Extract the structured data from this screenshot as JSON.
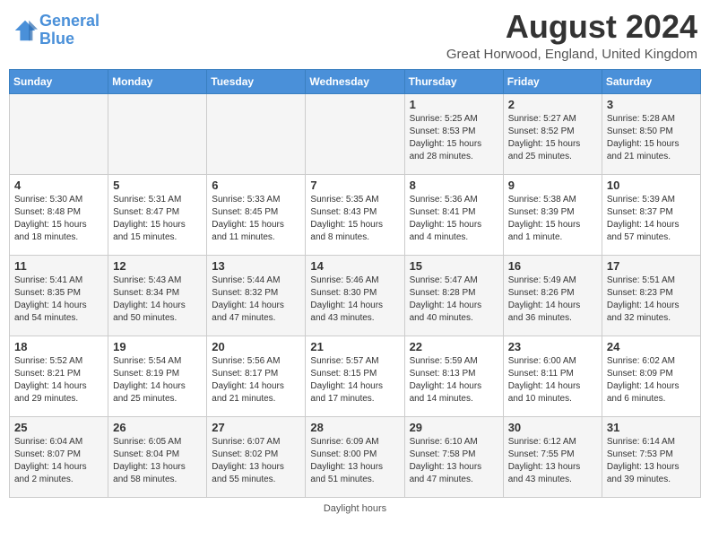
{
  "header": {
    "logo_general": "General",
    "logo_blue": "Blue",
    "month_title": "August 2024",
    "location": "Great Horwood, England, United Kingdom"
  },
  "days_of_week": [
    "Sunday",
    "Monday",
    "Tuesday",
    "Wednesday",
    "Thursday",
    "Friday",
    "Saturday"
  ],
  "weeks": [
    [
      {
        "day": "",
        "info": ""
      },
      {
        "day": "",
        "info": ""
      },
      {
        "day": "",
        "info": ""
      },
      {
        "day": "",
        "info": ""
      },
      {
        "day": "1",
        "info": "Sunrise: 5:25 AM\nSunset: 8:53 PM\nDaylight: 15 hours\nand 28 minutes."
      },
      {
        "day": "2",
        "info": "Sunrise: 5:27 AM\nSunset: 8:52 PM\nDaylight: 15 hours\nand 25 minutes."
      },
      {
        "day": "3",
        "info": "Sunrise: 5:28 AM\nSunset: 8:50 PM\nDaylight: 15 hours\nand 21 minutes."
      }
    ],
    [
      {
        "day": "4",
        "info": "Sunrise: 5:30 AM\nSunset: 8:48 PM\nDaylight: 15 hours\nand 18 minutes."
      },
      {
        "day": "5",
        "info": "Sunrise: 5:31 AM\nSunset: 8:47 PM\nDaylight: 15 hours\nand 15 minutes."
      },
      {
        "day": "6",
        "info": "Sunrise: 5:33 AM\nSunset: 8:45 PM\nDaylight: 15 hours\nand 11 minutes."
      },
      {
        "day": "7",
        "info": "Sunrise: 5:35 AM\nSunset: 8:43 PM\nDaylight: 15 hours\nand 8 minutes."
      },
      {
        "day": "8",
        "info": "Sunrise: 5:36 AM\nSunset: 8:41 PM\nDaylight: 15 hours\nand 4 minutes."
      },
      {
        "day": "9",
        "info": "Sunrise: 5:38 AM\nSunset: 8:39 PM\nDaylight: 15 hours\nand 1 minute."
      },
      {
        "day": "10",
        "info": "Sunrise: 5:39 AM\nSunset: 8:37 PM\nDaylight: 14 hours\nand 57 minutes."
      }
    ],
    [
      {
        "day": "11",
        "info": "Sunrise: 5:41 AM\nSunset: 8:35 PM\nDaylight: 14 hours\nand 54 minutes."
      },
      {
        "day": "12",
        "info": "Sunrise: 5:43 AM\nSunset: 8:34 PM\nDaylight: 14 hours\nand 50 minutes."
      },
      {
        "day": "13",
        "info": "Sunrise: 5:44 AM\nSunset: 8:32 PM\nDaylight: 14 hours\nand 47 minutes."
      },
      {
        "day": "14",
        "info": "Sunrise: 5:46 AM\nSunset: 8:30 PM\nDaylight: 14 hours\nand 43 minutes."
      },
      {
        "day": "15",
        "info": "Sunrise: 5:47 AM\nSunset: 8:28 PM\nDaylight: 14 hours\nand 40 minutes."
      },
      {
        "day": "16",
        "info": "Sunrise: 5:49 AM\nSunset: 8:26 PM\nDaylight: 14 hours\nand 36 minutes."
      },
      {
        "day": "17",
        "info": "Sunrise: 5:51 AM\nSunset: 8:23 PM\nDaylight: 14 hours\nand 32 minutes."
      }
    ],
    [
      {
        "day": "18",
        "info": "Sunrise: 5:52 AM\nSunset: 8:21 PM\nDaylight: 14 hours\nand 29 minutes."
      },
      {
        "day": "19",
        "info": "Sunrise: 5:54 AM\nSunset: 8:19 PM\nDaylight: 14 hours\nand 25 minutes."
      },
      {
        "day": "20",
        "info": "Sunrise: 5:56 AM\nSunset: 8:17 PM\nDaylight: 14 hours\nand 21 minutes."
      },
      {
        "day": "21",
        "info": "Sunrise: 5:57 AM\nSunset: 8:15 PM\nDaylight: 14 hours\nand 17 minutes."
      },
      {
        "day": "22",
        "info": "Sunrise: 5:59 AM\nSunset: 8:13 PM\nDaylight: 14 hours\nand 14 minutes."
      },
      {
        "day": "23",
        "info": "Sunrise: 6:00 AM\nSunset: 8:11 PM\nDaylight: 14 hours\nand 10 minutes."
      },
      {
        "day": "24",
        "info": "Sunrise: 6:02 AM\nSunset: 8:09 PM\nDaylight: 14 hours\nand 6 minutes."
      }
    ],
    [
      {
        "day": "25",
        "info": "Sunrise: 6:04 AM\nSunset: 8:07 PM\nDaylight: 14 hours\nand 2 minutes."
      },
      {
        "day": "26",
        "info": "Sunrise: 6:05 AM\nSunset: 8:04 PM\nDaylight: 13 hours\nand 58 minutes."
      },
      {
        "day": "27",
        "info": "Sunrise: 6:07 AM\nSunset: 8:02 PM\nDaylight: 13 hours\nand 55 minutes."
      },
      {
        "day": "28",
        "info": "Sunrise: 6:09 AM\nSunset: 8:00 PM\nDaylight: 13 hours\nand 51 minutes."
      },
      {
        "day": "29",
        "info": "Sunrise: 6:10 AM\nSunset: 7:58 PM\nDaylight: 13 hours\nand 47 minutes."
      },
      {
        "day": "30",
        "info": "Sunrise: 6:12 AM\nSunset: 7:55 PM\nDaylight: 13 hours\nand 43 minutes."
      },
      {
        "day": "31",
        "info": "Sunrise: 6:14 AM\nSunset: 7:53 PM\nDaylight: 13 hours\nand 39 minutes."
      }
    ]
  ],
  "footer": {
    "text": "Daylight hours"
  }
}
